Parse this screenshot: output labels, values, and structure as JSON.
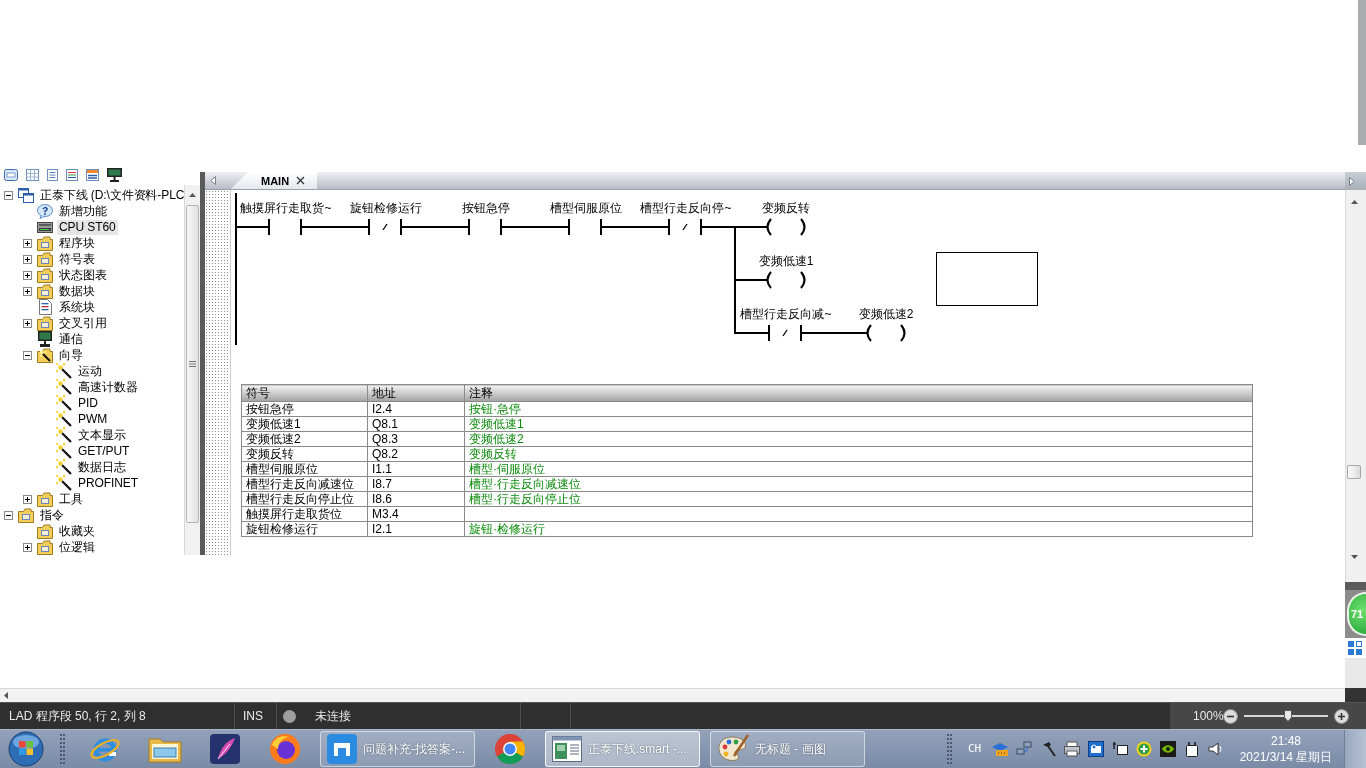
{
  "project_tree": {
    "items": [
      {
        "label": "正泰下线 (D:\\文件资料-PLC",
        "kind": "project",
        "selected": false,
        "expanded": true,
        "children": [
          {
            "label": "新增功能",
            "kind": "help",
            "selected": false
          },
          {
            "label": "CPU ST60",
            "kind": "cpu",
            "selected": true
          },
          {
            "label": "程序块",
            "kind": "folder",
            "selected": false,
            "expanded": false
          },
          {
            "label": "符号表",
            "kind": "folder",
            "selected": false,
            "expanded": false
          },
          {
            "label": "状态图表",
            "kind": "folder",
            "selected": false,
            "expanded": false
          },
          {
            "label": "数据块",
            "kind": "folder",
            "selected": false,
            "expanded": false
          },
          {
            "label": "系统块",
            "kind": "document",
            "selected": false
          },
          {
            "label": "交叉引用",
            "kind": "folder",
            "selected": false,
            "expanded": false
          },
          {
            "label": "通信",
            "kind": "monitor",
            "selected": false
          },
          {
            "label": "向导",
            "kind": "wizard",
            "selected": false,
            "expanded": true,
            "children": [
              {
                "label": "运动",
                "kind": "wand",
                "selected": false
              },
              {
                "label": "高速计数器",
                "kind": "wand",
                "selected": false
              },
              {
                "label": "PID",
                "kind": "wand",
                "selected": false
              },
              {
                "label": "PWM",
                "kind": "wand",
                "selected": false
              },
              {
                "label": "文本显示",
                "kind": "wand",
                "selected": false
              },
              {
                "label": "GET/PUT",
                "kind": "wand",
                "selected": false
              },
              {
                "label": "数据日志",
                "kind": "wand",
                "selected": false
              },
              {
                "label": "PROFINET",
                "kind": "wand",
                "selected": false
              }
            ]
          },
          {
            "label": "工具",
            "kind": "folder",
            "selected": false,
            "expanded": false
          }
        ]
      },
      {
        "label": "指令",
        "kind": "folder",
        "selected": false,
        "expanded": true,
        "children": [
          {
            "label": "收藏夹",
            "kind": "folder",
            "selected": false
          },
          {
            "label": "位逻辑",
            "kind": "folder",
            "selected": false,
            "expanded": false
          }
        ]
      }
    ]
  },
  "editor": {
    "tabs": [
      {
        "label": "MAIN",
        "selected": true
      }
    ],
    "network": {
      "contacts": [
        {
          "label": "触摸屏行走取货~",
          "kind": "no"
        },
        {
          "label": "旋钮检修运行",
          "kind": "nc"
        },
        {
          "label": "按钮急停",
          "kind": "no"
        },
        {
          "label": "槽型伺服原位",
          "kind": "no"
        },
        {
          "label": "槽型行走反向停~",
          "kind": "nc"
        }
      ],
      "branches": [
        {
          "coil": "变频反转"
        },
        {
          "coil": "变频低速1"
        },
        {
          "contacts": [
            {
              "label": "槽型行走反向减~",
              "kind": "nc"
            }
          ],
          "coil": "变频低速2"
        }
      ]
    },
    "symbol_table": {
      "columns": [
        "符号",
        "地址",
        "注释"
      ],
      "rows": [
        {
          "symbol": "按钮急停",
          "address": "I2.4",
          "comment": "按钮·急停"
        },
        {
          "symbol": "变频低速1",
          "address": "Q8.1",
          "comment": "变频低速1"
        },
        {
          "symbol": "变频低速2",
          "address": "Q8.3",
          "comment": "变频低速2"
        },
        {
          "symbol": "变频反转",
          "address": "Q8.2",
          "comment": "变频反转"
        },
        {
          "symbol": "槽型伺服原位",
          "address": "I1.1",
          "comment": "槽型·伺服原位"
        },
        {
          "symbol": "槽型行走反向减速位",
          "address": "I8.7",
          "comment": "槽型·行走反向减速位"
        },
        {
          "symbol": "槽型行走反向停止位",
          "address": "I8.6",
          "comment": "槽型·行走反向停止位"
        },
        {
          "symbol": "触摸屏行走取货位",
          "address": "M3.4"
        },
        {
          "symbol": "旋钮检修运行",
          "address": "I2.1",
          "comment": "旋钮·检修运行"
        }
      ]
    }
  },
  "floating_ball": {
    "text": "71"
  },
  "status_bar": {
    "position": "LAD 程序段 50, 行 2, 列 8",
    "insert_mode": "INS",
    "connected": false,
    "connection": "未连接",
    "zoom": {
      "reading": "100%",
      "level": 0.52
    }
  },
  "taskbar": {
    "items": [
      {
        "kind": "ebrowser",
        "selected": false
      },
      {
        "kind": "explorer",
        "selected": false
      },
      {
        "kind": "feather",
        "selected": false
      },
      {
        "kind": "foxbrowser",
        "selected": false
      },
      {
        "kind": "mbrowser",
        "label": "问题补充-找答案-...",
        "selected": false
      },
      {
        "kind": "ringbrowser",
        "selected": false
      },
      {
        "kind": "ladderapp",
        "label": "正泰下线.smart -...",
        "selected": true
      },
      {
        "kind": "palette",
        "label": "无标题 - 画图",
        "selected": false
      }
    ],
    "language": "CH",
    "time": "21:48",
    "date": "2021/3/14 星期日"
  }
}
